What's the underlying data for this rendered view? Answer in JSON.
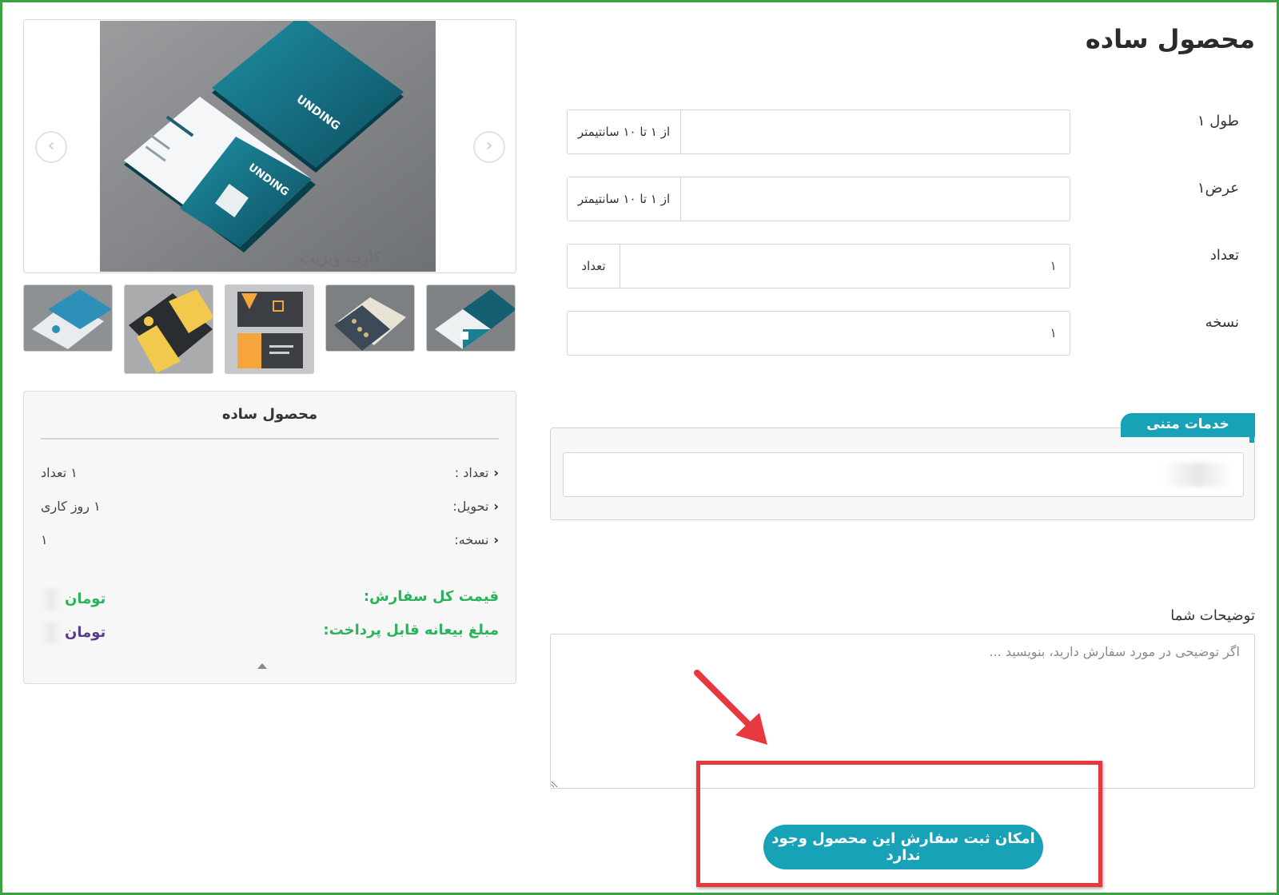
{
  "page": {
    "title": "محصول ساده"
  },
  "gallery": {
    "watermark": "کارت ویزیت",
    "thumbnails": [
      "thumb-1",
      "thumb-2",
      "thumb-3",
      "thumb-4",
      "thumb-5"
    ],
    "prev_icon": "chevron-left-icon",
    "next_icon": "chevron-right-icon"
  },
  "form": {
    "length": {
      "label": "طول ۱",
      "addon": "از ۱ تا ۱۰ سانتیمتر",
      "value": ""
    },
    "width": {
      "label": "عرض۱",
      "addon": "از ۱ تا ۱۰ سانتیمتر",
      "value": ""
    },
    "quantity": {
      "label": "تعداد",
      "addon": "تعداد",
      "value": "۱"
    },
    "copies": {
      "label": "نسخه",
      "value": "۱"
    }
  },
  "services": {
    "tab_label": "خدمات متنی"
  },
  "notes": {
    "label": "توضیحات شما",
    "placeholder": "اگر توضیحی در مورد سفارش دارید، بنویسید ..."
  },
  "summary": {
    "title": "محصول ساده",
    "rows": [
      {
        "label": "تعداد :",
        "value": "۱ تعداد"
      },
      {
        "label": "تحویل:",
        "value": "۱ روز کاری"
      },
      {
        "label": "نسخه:",
        "value": "۱"
      }
    ],
    "total_label": "قیمت کل سفارش:",
    "total_value": "تومان",
    "deposit_label": "مبلغ بیعانه قابل پرداخت:",
    "deposit_value": "تومان"
  },
  "submit": {
    "label": "امکان ثبت سفارش این محصول وجود ندارد"
  },
  "colors": {
    "accent": "#17a2b8",
    "price_green": "#2bb35b",
    "deposit_purple": "#5b3b8c",
    "annotation_red": "#e6383d",
    "frame_green": "#3aa341"
  }
}
